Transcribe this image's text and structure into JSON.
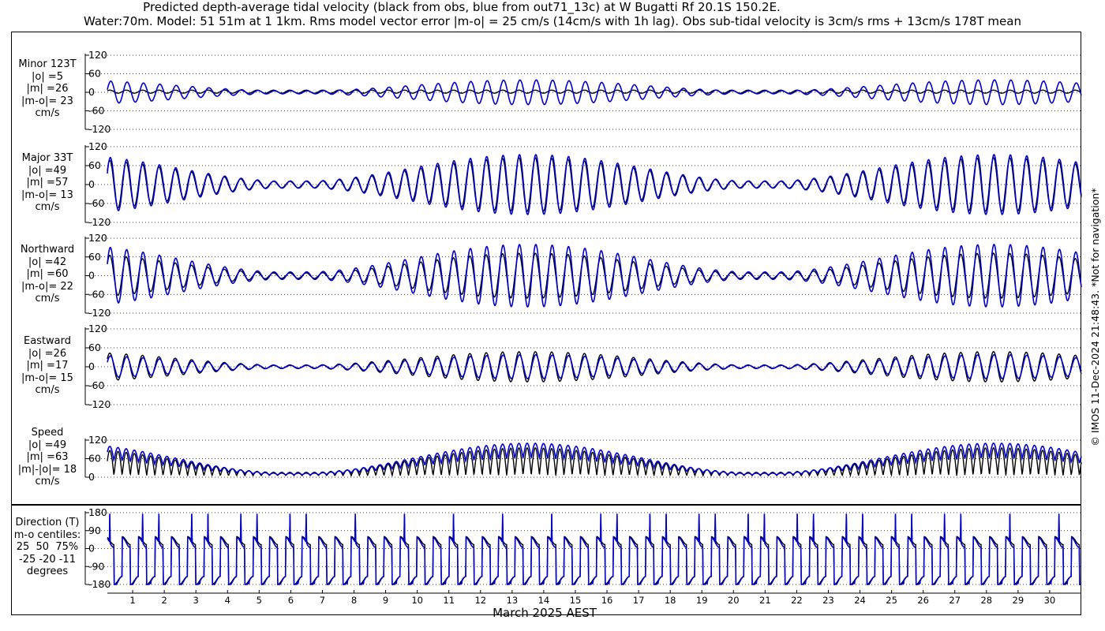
{
  "title_line1": "Predicted depth-average tidal velocity (black from obs, blue from out71_13c) at W Bugatti Rf 20.1S 150.2E.",
  "title_line2": "Water:70m. Model: 51 51m at 1 1km. Rms model vector error |m-o| = 25 cm/s (14cm/s with 1h lag). Obs sub-tidal velocity is 3cm/s rms + 13cm/s 178T mean",
  "credit": "© IMOS 11-Dec-2024 21:48:43. *Not for navigation*",
  "colors": {
    "obs": "#000000",
    "model": "#0000cc"
  },
  "chart_data": [
    {
      "type": "line",
      "panel": "minor",
      "labels": [
        "Minor 123T",
        "|o| =5",
        "|m| =26",
        "|m-o|= 23",
        "cm/s"
      ],
      "ylim": [
        -120,
        120
      ],
      "yticks": [
        "120",
        "60",
        "0",
        "-60",
        "-120"
      ],
      "obs_amplitude": 5,
      "model_amplitude": 40,
      "series": [
        {
          "name": "obs"
        },
        {
          "name": "model"
        }
      ]
    },
    {
      "type": "line",
      "panel": "major",
      "labels": [
        "Major 33T",
        "|o| =49",
        "|m| =57",
        "|m-o|= 13",
        "cm/s"
      ],
      "ylim": [
        -120,
        120
      ],
      "yticks": [
        "120",
        "60",
        "0",
        "-60",
        "-120"
      ],
      "obs_amplitude": 85,
      "model_amplitude": 95,
      "series": [
        {
          "name": "obs"
        },
        {
          "name": "model"
        }
      ]
    },
    {
      "type": "line",
      "panel": "northward",
      "labels": [
        "Northward",
        "|o| =42",
        "|m| =60",
        "|m-o|= 22",
        "cm/s"
      ],
      "ylim": [
        -120,
        120
      ],
      "yticks": [
        "120",
        "60",
        "0",
        "-60",
        "-120"
      ],
      "obs_amplitude": 72,
      "model_amplitude": 100,
      "series": [
        {
          "name": "obs"
        },
        {
          "name": "model"
        }
      ]
    },
    {
      "type": "line",
      "panel": "eastward",
      "labels": [
        "Eastward",
        "|o| =26",
        "|m| =17",
        "|m-o|= 15",
        "cm/s"
      ],
      "ylim": [
        -120,
        120
      ],
      "yticks": [
        "120",
        "60",
        "0",
        "-60",
        "-120"
      ],
      "obs_amplitude": 48,
      "model_amplitude": 38,
      "series": [
        {
          "name": "obs"
        },
        {
          "name": "model"
        }
      ]
    },
    {
      "type": "line",
      "panel": "speed",
      "labels": [
        "Speed",
        "|o| =49",
        "|m| =63",
        "|m|-|o|= 18",
        "cm/s"
      ],
      "ylim": [
        0,
        120
      ],
      "yticks": [
        "120",
        "60",
        "0"
      ],
      "obs_amplitude": 90,
      "model_amplitude": 110,
      "series": [
        {
          "name": "obs"
        },
        {
          "name": "model"
        }
      ]
    },
    {
      "type": "line",
      "panel": "direction",
      "labels": [
        "Direction (T)",
        "m-o centiles:",
        "25  50  75%",
        "-25 -20 -11",
        "degrees"
      ],
      "ylim": [
        -180,
        180
      ],
      "yticks": [
        "180",
        "90",
        "0",
        "-90",
        "-180"
      ],
      "series": [
        {
          "name": "obs"
        },
        {
          "name": "model"
        }
      ]
    }
  ],
  "x_axis": {
    "label": "March 2025 AEST",
    "days": [
      "1",
      "2",
      "3",
      "4",
      "5",
      "6",
      "7",
      "8",
      "9",
      "10",
      "11",
      "12",
      "13",
      "14",
      "15",
      "16",
      "17",
      "18",
      "19",
      "20",
      "21",
      "22",
      "23",
      "24",
      "25",
      "26",
      "27",
      "28",
      "29",
      "30"
    ],
    "range_days": [
      0.2,
      31.0
    ]
  }
}
